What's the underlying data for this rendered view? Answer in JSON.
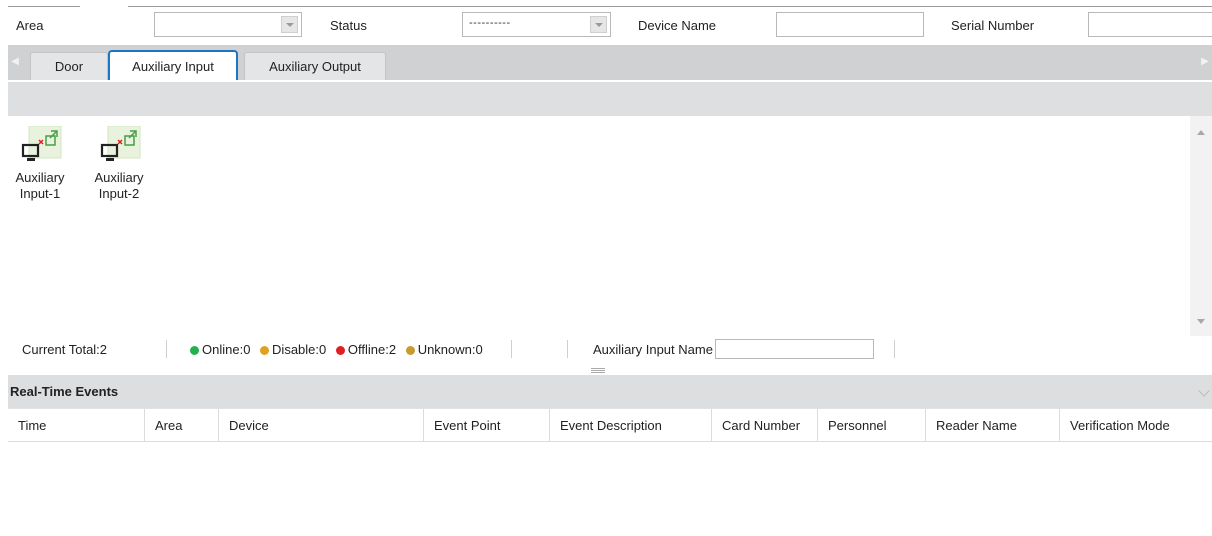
{
  "filters": {
    "area_label": "Area",
    "area_value": "",
    "status_label": "Status",
    "status_value": "----------",
    "device_name_label": "Device Name",
    "device_name_value": "",
    "serial_number_label": "Serial Number",
    "serial_number_value": ""
  },
  "tabs": [
    {
      "label": "Door",
      "active": false
    },
    {
      "label": "Auxiliary Input",
      "active": true
    },
    {
      "label": "Auxiliary Output",
      "active": false
    }
  ],
  "devices": [
    {
      "label_line1": "Auxiliary",
      "label_line2": "Input-1",
      "icon": "auxiliary-input-offline-icon"
    },
    {
      "label_line1": "Auxiliary",
      "label_line2": "Input-2",
      "icon": "auxiliary-input-offline-icon"
    }
  ],
  "status_bar": {
    "current_total": "Current Total:2",
    "online": "Online:0",
    "disable": "Disable:0",
    "offline": "Offline:2",
    "unknown": "Unknown:0",
    "name_filter_label": "Auxiliary Input Name",
    "name_filter_value": ""
  },
  "status_colors": {
    "online": "#22b14c",
    "disable": "#e0a020",
    "offline": "#e02020",
    "unknown": "#c89a30"
  },
  "events": {
    "title": "Real-Time Events",
    "columns": [
      "Time",
      "Area",
      "Device",
      "Event Point",
      "Event Description",
      "Card Number",
      "Personnel",
      "Reader Name",
      "Verification Mode"
    ],
    "rows": []
  },
  "accent_color": "#1c76c4"
}
